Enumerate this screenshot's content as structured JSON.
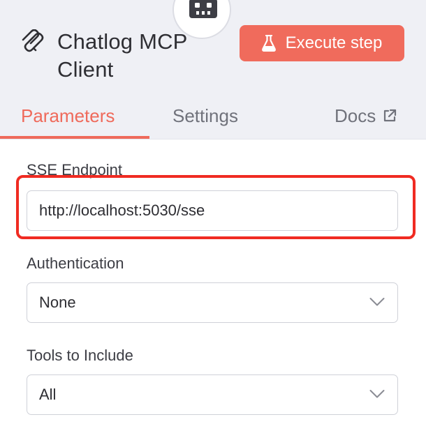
{
  "node": {
    "icon": "robot-icon",
    "title": "Chatlog MCP Client",
    "brand_icon": "mcp-logo-icon"
  },
  "toolbar": {
    "execute_label": "Execute step",
    "execute_icon": "flask-icon",
    "execute_color": "#f06b5c"
  },
  "tabs": [
    {
      "label": "Parameters",
      "active": true
    },
    {
      "label": "Settings",
      "active": false
    },
    {
      "label": "Docs",
      "active": false,
      "icon": "external-link-icon"
    }
  ],
  "form": {
    "sse_endpoint": {
      "label": "SSE Endpoint",
      "value": "http://localhost:5030/sse"
    },
    "authentication": {
      "label": "Authentication",
      "value": "None"
    },
    "tools_to_include": {
      "label": "Tools to Include",
      "value": "All"
    }
  },
  "colors": {
    "accent": "#ef6a5b",
    "highlight": "#f02b22",
    "header_bg": "#eff0f5"
  }
}
